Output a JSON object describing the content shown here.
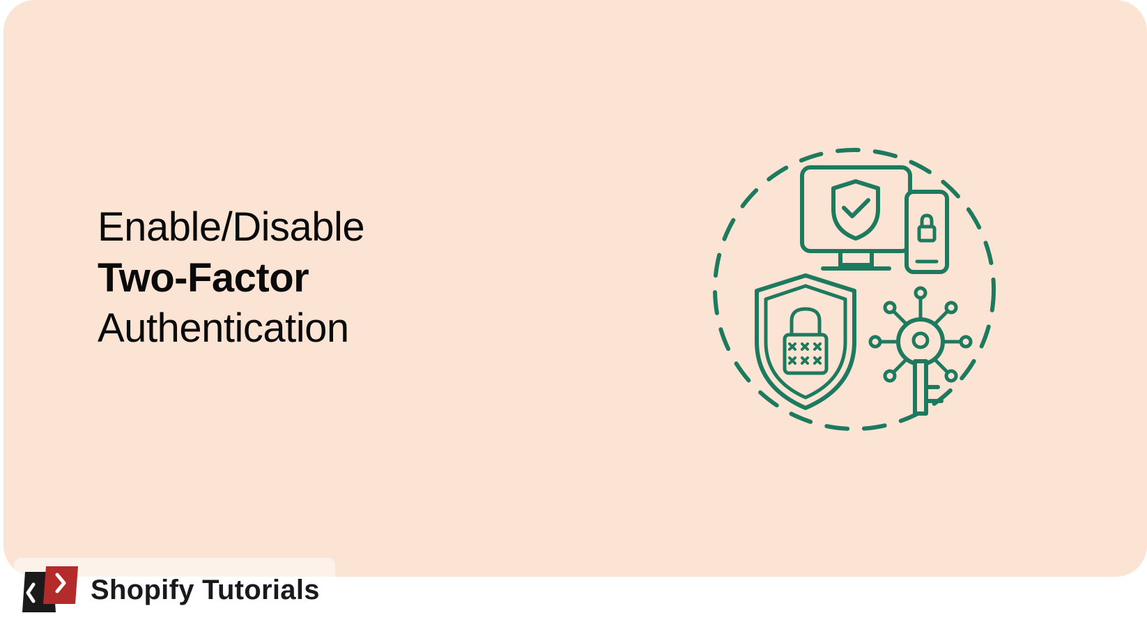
{
  "heading": {
    "line1": "Enable/Disable",
    "line2": "Two-Factor",
    "line3": "Authentication"
  },
  "badge": {
    "text": "Shopify Tutorials"
  },
  "colors": {
    "card_bg": "#fbe4d4",
    "text": "#0a0a0a",
    "icon_stroke": "#1d7a5e",
    "badge_red": "#b32b2b",
    "badge_dark": "#1a1a1a"
  }
}
